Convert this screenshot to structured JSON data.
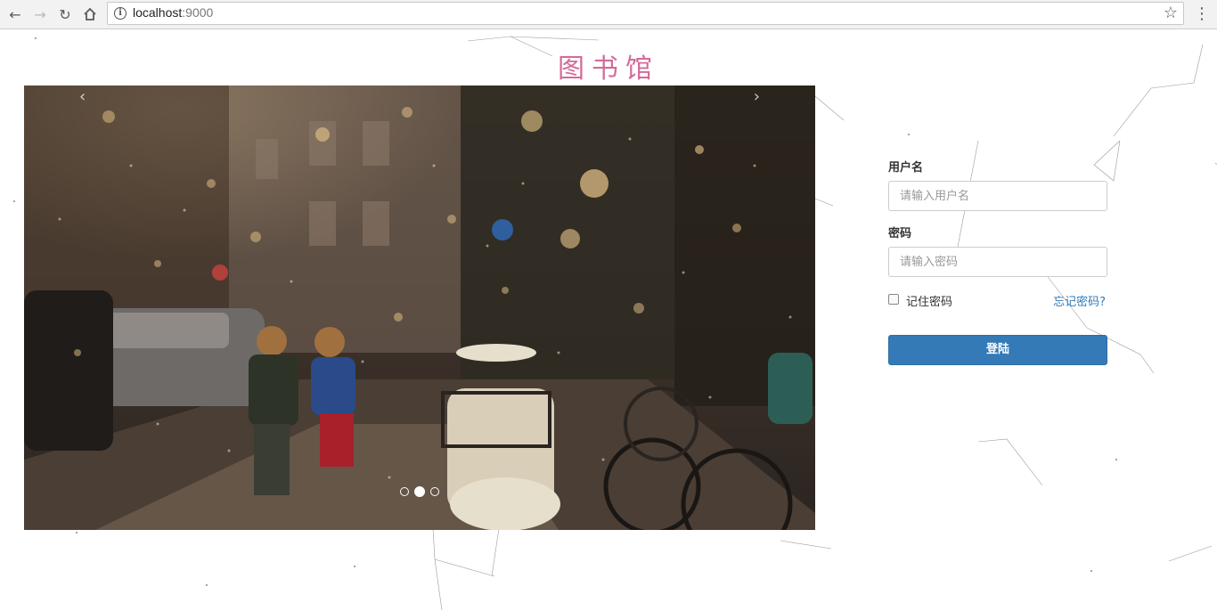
{
  "browser": {
    "url_host": "localhost",
    "url_port": ":9000",
    "back_icon": "back-arrow-icon",
    "forward_icon": "forward-arrow-icon",
    "reload_icon": "reload-icon",
    "home_icon": "home-icon",
    "info_icon": "info-icon",
    "bookmark_icon": "star-icon",
    "menu_icon": "kebab-menu-icon"
  },
  "page": {
    "title": "图书馆",
    "title_color": "#d36b9a"
  },
  "carousel": {
    "prev_label": "‹",
    "next_label": "›",
    "slide_count": 3,
    "active_index": 1,
    "image_subject": "children-walking-in-rain-street"
  },
  "login": {
    "username_label": "用户名",
    "username_placeholder": "请输入用户名",
    "password_label": "密码",
    "password_placeholder": "请输入密码",
    "remember_label": "记住密码",
    "remember_checked": false,
    "forgot_label": "忘记密码?",
    "submit_label": "登陆",
    "accent_color": "#337ab7"
  }
}
